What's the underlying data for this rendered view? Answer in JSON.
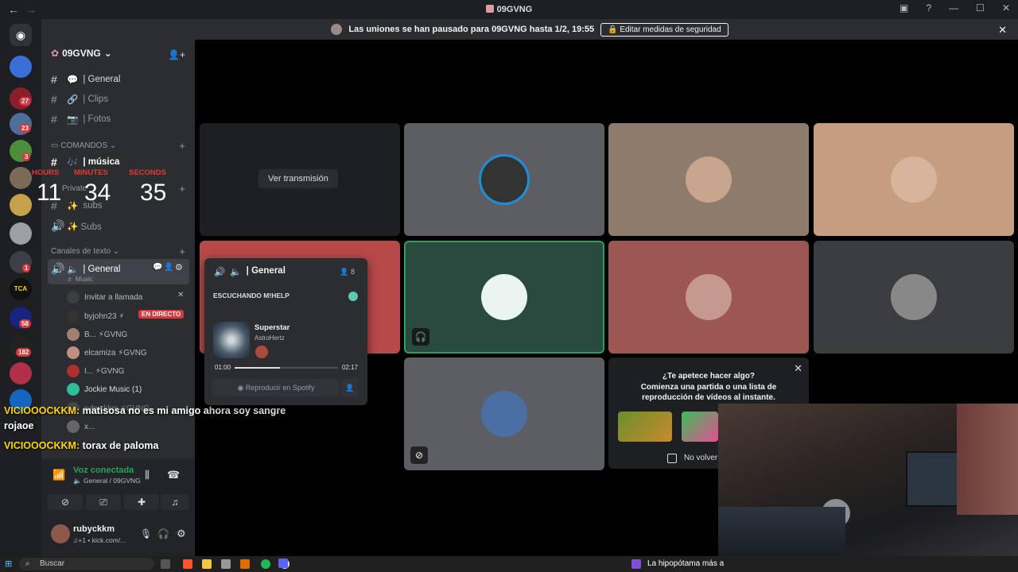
{
  "window": {
    "title": "09GVNG"
  },
  "notice": {
    "text": "Las uniones se han pausado para 09GVNG hasta 1/2, 19:55",
    "button": "Editar medidas de seguridad"
  },
  "rail_badges": [
    "27",
    "23",
    "3",
    "1",
    "58",
    "182"
  ],
  "server": {
    "name": "09GVNG"
  },
  "channels": {
    "top": [
      {
        "name": "| General",
        "icon": "💬"
      },
      {
        "name": "| Clips",
        "icon": "🔗"
      },
      {
        "name": "| Fotos",
        "icon": "📷"
      }
    ],
    "cat_commands": "COMANDOS",
    "musica": "| música",
    "private_label": "Private",
    "subs_text": "subs",
    "subs_voice": "✨ Subs",
    "cat_text": "Canales de texto",
    "general_voice": "| General",
    "general_sub": "♬ Music",
    "invite": "Invitar a llamada",
    "members": [
      {
        "name": "byjohn23 ⚡",
        "tag": "EN DIRECTO"
      },
      {
        "name": "B... ⚡GVNG"
      },
      {
        "name": "elcamiza ⚡GVNG"
      },
      {
        "name": "I... ⚡GVNG"
      },
      {
        "name": "Jockie Music (1)"
      },
      {
        "name": "rubyckkm ⚡GVNG"
      },
      {
        "name": "x..."
      }
    ]
  },
  "timer": {
    "hours_label": "HOURS",
    "minutes_label": "MINUTES",
    "seconds_label": "SECONDS",
    "hours": "11",
    "minutes": "34",
    "seconds": "35"
  },
  "chat": [
    {
      "user": "VICIOOOCKKM:",
      "text": " matisosa no es mi amigo ahora soy sangre"
    },
    {
      "user": "",
      "text": "rojaoe"
    },
    {
      "user": "VICIOOOCKKM:",
      "text": " torax de paloma"
    }
  ],
  "voice": {
    "status": "Voz conectada",
    "location": "General / 09GVNG"
  },
  "user": {
    "name": "rubyckkm",
    "status": "♫+1 • kick.com/..."
  },
  "stage": {
    "watch_stream": "Ver transmisión"
  },
  "popup": {
    "channel": "| General",
    "count": "8",
    "listening": "ESCUCHANDO M!HELP",
    "song": "Superstar",
    "artist": "AstroHertz",
    "time_current": "01:00",
    "time_total": "02:17",
    "progress": 0.44,
    "spotify_button": "Reproducir en Spotify"
  },
  "activity": {
    "title": "¿Te apetece hacer algo?",
    "subtitle": "Comienza una partida o una lista de reproducción de vídeos al instante.",
    "checkbox": "No volver"
  },
  "taskbar": {
    "search_placeholder": "Buscar",
    "notification": "La hipopótama más a"
  }
}
